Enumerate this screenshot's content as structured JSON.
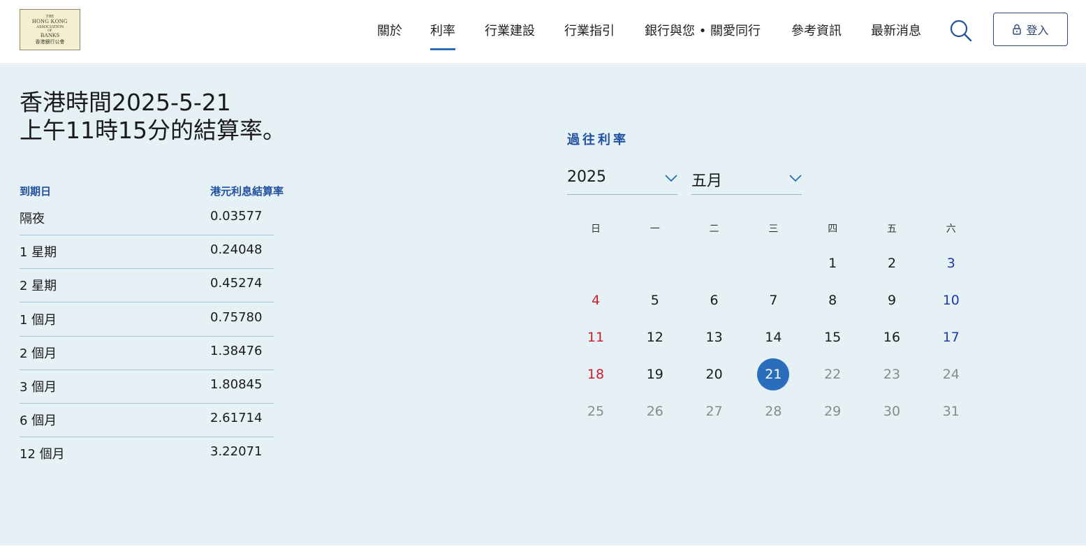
{
  "logo": {
    "line1": "THE",
    "line2": "HONG KONG",
    "line3": "ASSOCIATION",
    "line4": "OF",
    "line5": "BANKS",
    "line6": "香港銀行公會"
  },
  "nav": {
    "items": [
      {
        "label": "關於"
      },
      {
        "label": "利率"
      },
      {
        "label": "行業建設"
      },
      {
        "label": "行業指引"
      },
      {
        "label": "銀行與您 • 關愛同行"
      },
      {
        "label": "參考資訊"
      },
      {
        "label": "最新消息"
      }
    ],
    "active_index": 1,
    "login_label": "登入"
  },
  "rates": {
    "title_line1": "香港時間2025-5-21",
    "title_line2": "上午11時15分的結算率。",
    "col_term": "到期日",
    "col_rate": "港元利息結算率",
    "rows": [
      {
        "term": "隔夜",
        "rate": "0.03577"
      },
      {
        "term": "1 星期",
        "rate": "0.24048"
      },
      {
        "term": "2 星期",
        "rate": "0.45274"
      },
      {
        "term": "1 個月",
        "rate": "0.75780"
      },
      {
        "term": "2 個月",
        "rate": "1.38476"
      },
      {
        "term": "3 個月",
        "rate": "1.80845"
      },
      {
        "term": "6 個月",
        "rate": "2.61714"
      },
      {
        "term": "12 個月",
        "rate": "3.22071"
      }
    ]
  },
  "history": {
    "title": "過往利率",
    "year": "2025",
    "month": "五月",
    "weekdays": [
      "日",
      "一",
      "二",
      "三",
      "四",
      "五",
      "六"
    ],
    "first_weekday": 4,
    "days_in_month": 31,
    "selected_day": 21,
    "last_available_day": 21,
    "colors": {
      "sunday": "#c8202d",
      "saturday": "#1d3bb0",
      "selected": "#2a6ebb",
      "future": "#8a8a8a"
    }
  }
}
